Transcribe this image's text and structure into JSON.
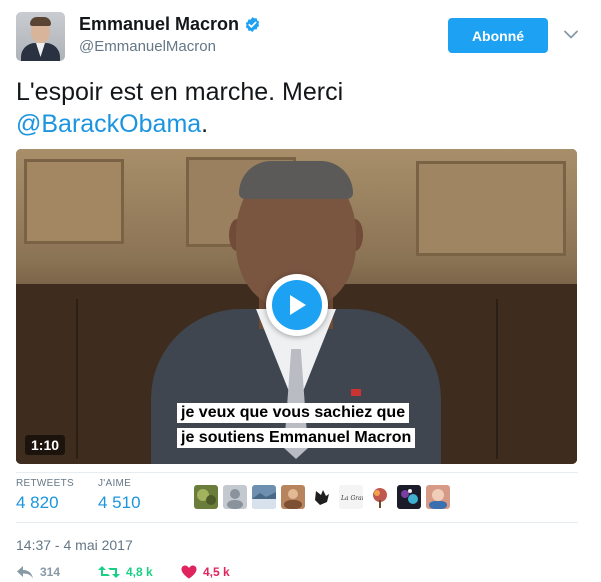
{
  "author": {
    "name": "Emmanuel Macron",
    "handle": "@EmmanuelMacron",
    "verified": true
  },
  "follow_button": {
    "label": "Abonné"
  },
  "tweet": {
    "text_before": "L'espoir est en marche. Merci",
    "mention": "@BarackObama",
    "text_after": "."
  },
  "media": {
    "subtitle_line1": "je veux que vous sachiez que",
    "subtitle_line2": "je soutiens Emmanuel Macron",
    "duration": "1:10",
    "icon": "play-icon"
  },
  "stats": {
    "retweets_label": "RETWEETS",
    "retweets_value": "4 820",
    "likes_label": "J'AIME",
    "likes_value": "4 510"
  },
  "likers": [
    {
      "icon": "liker-avatar",
      "color": "#6b7d3a"
    },
    {
      "icon": "liker-avatar",
      "color": "#9aa3ad"
    },
    {
      "icon": "liker-avatar",
      "color": "#6f8fb0"
    },
    {
      "icon": "liker-avatar",
      "color": "#b7845e"
    },
    {
      "icon": "liker-avatar",
      "color": "#2a2a2a"
    },
    {
      "icon": "liker-avatar",
      "color": "#f2f2f2"
    },
    {
      "icon": "liker-avatar",
      "color": "#c0584f"
    },
    {
      "icon": "liker-avatar",
      "color": "#7a3fa0"
    },
    {
      "icon": "liker-avatar",
      "color": "#d69a86"
    }
  ],
  "liker_handwriting": "La Grande !",
  "timestamp": "14:37 - 4 mai 2017",
  "actions": {
    "reply_count": "314",
    "retweet_count": "4,8 k",
    "like_count": "4,5 k"
  },
  "colors": {
    "accent": "#1da1f2",
    "link": "#1b95e0",
    "retweet": "#19cf86",
    "like": "#e0245e",
    "muted": "#657786"
  }
}
